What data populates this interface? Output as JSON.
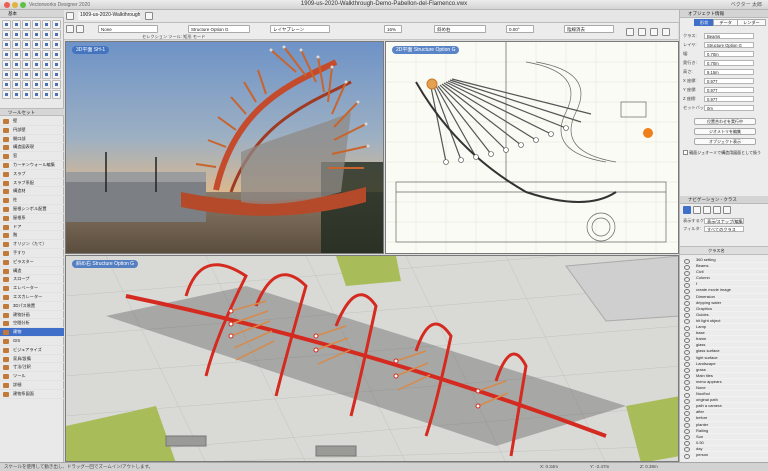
{
  "window": {
    "title": "1909-us-2020-Walkthrough-Demo-Pabellon-del-Flamenco.vwx",
    "app": "Vectorworks Designer 2020",
    "user": "ベクター 太郎"
  },
  "toolbar": {
    "class_field": "None",
    "layer_field": "Structure Option G",
    "plane_field": "レイヤプレーン",
    "zoom": "16%",
    "view_field": "斜め右",
    "angle": "0.00°",
    "render_field": "陰線消去",
    "mode_text": "セレクション ツール: 矩形 モード",
    "tab_file": "1909-us-2020-Walkthrough..."
  },
  "palette": {
    "title": "基本",
    "toolset_title": "ツールセット"
  },
  "toolsets": [
    "壁",
    "円部壁",
    "開口部",
    "構造図表現",
    "窓",
    "カーテンウォール編集",
    "スラブ",
    "スラブ系配",
    "構造材",
    "柱",
    "屋根シンボル配置",
    "屋根系",
    "ドア",
    "階",
    "オリジン（たて）",
    "手すり",
    "ピラスター",
    "構造",
    "スロープ",
    "エレベーター",
    "エスカレーター",
    "3Dパス装置",
    "建物計画",
    "空間分析",
    "建物",
    "GIS",
    "ビジュアライズ",
    "家具/設備",
    "寸法/注釈",
    "ツール",
    "詳細",
    "建物系図面"
  ],
  "selected_toolset": "建物",
  "viewports": [
    {
      "label": "3D平面 SH-1"
    },
    {
      "label": "2D平面  Structure Option G"
    },
    {
      "label": "斜め右  Structure Option G"
    }
  ],
  "obj_info": {
    "title": "オブジェクト情報",
    "tabs": [
      "形状",
      "データ",
      "レンダー"
    ],
    "rows": [
      {
        "label": "クラス:",
        "value": "Beams"
      },
      {
        "label": "レイヤ:",
        "value": "Structure Option G"
      },
      {
        "label": "幅:",
        "value": "0.70m"
      },
      {
        "label": "奥行き:",
        "value": "0.70m"
      },
      {
        "label": "高さ:",
        "value": "9.15m"
      },
      {
        "label": "X 座標:",
        "value": "0.977"
      },
      {
        "label": "Y 座標:",
        "value": "0.977"
      },
      {
        "label": "Z 座標:",
        "value": "0.977"
      },
      {
        "label": "セットバック:",
        "value": "0m"
      }
    ],
    "buttons": [
      "位置合わせを実行中",
      "ジオメトリを編集",
      "オブジェクト表示"
    ],
    "checkbox": "親面ジェオーミで構造用図面として扱う"
  },
  "nav": {
    "title": "ナビゲーション - クラス",
    "display_label": "表示するクラス:",
    "display_value": "表示/スナップ/編集",
    "filter_label": "フィルタ:",
    "filter_value": "すべてのクラス",
    "header": "クラス名",
    "classes": [
      "360 setting",
      "Beams",
      "Civil",
      "Column",
      "f",
      "create movie image",
      "Dimension",
      "dripping water",
      "Graphics",
      "Guides",
      "hit light object",
      "Lamp",
      "base",
      "frame",
      "glass",
      "glass surface",
      "light surface",
      "Landscape",
      "grass",
      "Main tiles",
      "menu appears",
      "None",
      "Noofhol",
      "original path",
      "path a camera",
      "after",
      "before",
      "planter",
      "Railing",
      "Sun",
      "0.50",
      "day",
      "person"
    ]
  },
  "status": "スケールを使用して動き出し、ドラッグ一回でズームイン/アウトします。",
  "coords": {
    "x": "X: 0.34m",
    "y": "Y: -2.47m",
    "z": "Z: 0.38m"
  },
  "icons": [
    "close-icon",
    "minimize-icon",
    "zoom-icon",
    "undo-icon",
    "pan-icon",
    "zoom-tool-icon",
    "camera-icon"
  ]
}
